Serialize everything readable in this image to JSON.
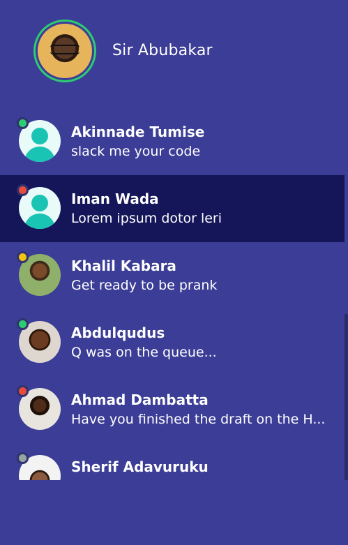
{
  "profile": {
    "name": "Sir Abubakar",
    "status_color": "#2ecc71"
  },
  "conversations": [
    {
      "name": "Akinnade Tumise",
      "message": "slack me your code",
      "status": "online",
      "avatar": "default-avatar-icon"
    },
    {
      "name": "Iman Wada",
      "message": "Lorem ipsum dotor leri",
      "status": "busy",
      "avatar": "default-avatar-icon",
      "active": true
    },
    {
      "name": "Khalil Kabara",
      "message": "Get ready to be prank",
      "status": "away",
      "avatar": "photo"
    },
    {
      "name": "Abdulqudus",
      "message": "Q was on the queue...",
      "status": "online",
      "avatar": "photo"
    },
    {
      "name": "Ahmad Dambatta",
      "message": "Have you finished the draft on the H...",
      "status": "busy",
      "avatar": "photo"
    },
    {
      "name": "Sherif Adavuruku",
      "message": "",
      "status": "offline",
      "avatar": "photo"
    }
  ],
  "colors": {
    "background": "#3b3d96",
    "active_row": "#15165a",
    "online": "#2ecc71",
    "busy": "#e74c3c",
    "away": "#f1c40f",
    "offline": "#95a5a6"
  }
}
